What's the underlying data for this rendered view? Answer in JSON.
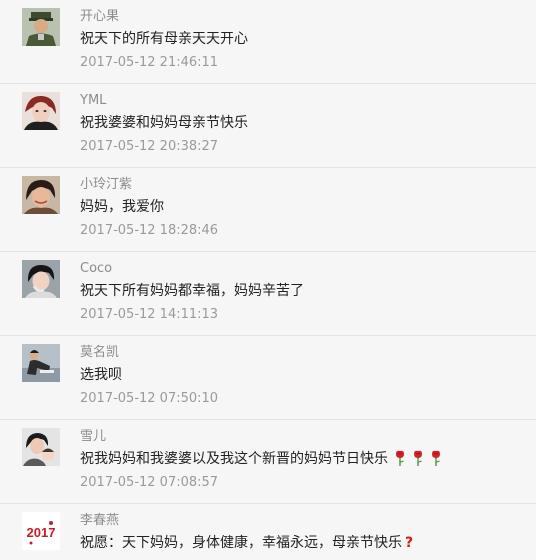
{
  "comments": [
    {
      "name": "开心果",
      "content": "祝天下的所有母亲天天开心",
      "time": "2017-05-12 21:46:11",
      "avatar": "avatar-military-man"
    },
    {
      "name": "YML",
      "content": "祝我婆婆和妈妈母亲节快乐",
      "time": "2017-05-12 20:38:27",
      "avatar": "avatar-woman-red-hair"
    },
    {
      "name": "小玲汀紫",
      "content": "妈妈，我爱你",
      "time": "2017-05-12 18:28:46",
      "avatar": "avatar-smiling-woman"
    },
    {
      "name": "Coco",
      "content": "祝天下所有妈妈都幸福，妈妈辛苦了",
      "time": "2017-05-12 14:11:13",
      "avatar": "avatar-woman-short-hair"
    },
    {
      "name": "莫名凯",
      "content": "选我呗",
      "time": "2017-05-12 07:50:10",
      "avatar": "avatar-man-sitting"
    },
    {
      "name": "雪儿",
      "content": "祝我妈妈和我婆婆以及我这个新晋的妈妈节日快乐",
      "time": "2017-05-12 07:08:57",
      "avatar": "avatar-mother-child",
      "emoji": [
        "rose-icon",
        "rose-icon",
        "rose-icon"
      ]
    },
    {
      "name": "李春燕",
      "content": "祝愿：天下妈妈，身体健康，幸福永远，母亲节快乐",
      "time": "",
      "avatar": "avatar-2017-logo",
      "emoji": [
        "question-mark-icon"
      ],
      "avatar_text": "2017"
    }
  ]
}
